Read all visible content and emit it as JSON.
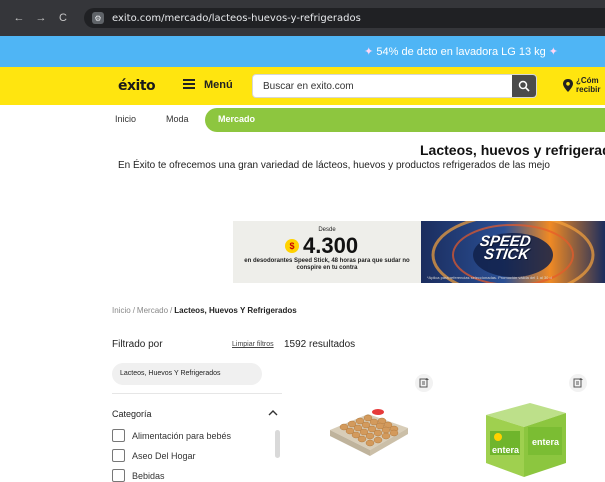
{
  "browser": {
    "url": "exito.com/mercado/lacteos-huevos-y-refrigerados",
    "back": "←",
    "forward": "→",
    "reload": "C"
  },
  "promo": {
    "text": "54% de dcto en lavadora LG 13 kg"
  },
  "header": {
    "logo": "éxito",
    "menu_label": "Menú",
    "search_placeholder": "Buscar en exito.com",
    "location_line1": "¿Cóm",
    "location_line2": "recibir"
  },
  "nav": {
    "items": [
      "Inicio",
      "Moda"
    ],
    "active": "Mercado"
  },
  "page": {
    "title": "Lacteos, huevos y refrigerado",
    "description": "En Éxito te ofrecemos una gran variedad de lácteos, huevos y productos refrigerados de las mejo"
  },
  "banner": {
    "desde": "Desde",
    "price_sign": "$",
    "price": "4.300",
    "subtitle": "en desodorantes Speed Stick, 48 horas para que sudar no conspire en tu contra",
    "brand_line1": "SPEED",
    "brand_line2": "STICK",
    "fine_print": "*Aplica para referencias seleccionadas. Promoción válida del 1 al 30 d"
  },
  "breadcrumb": {
    "items": [
      "Inicio",
      "Mercado"
    ],
    "current": "Lacteos, Huevos Y Refrigerados"
  },
  "filters": {
    "title": "Filtrado por",
    "clear": "Limpiar filtros",
    "results": "1592 resultados",
    "active_chip": "Lacteos, Huevos Y Refrigerados",
    "category_title": "Categoría",
    "options": [
      "Alimentación para bebés",
      "Aseo Del Hogar",
      "Bebidas"
    ]
  },
  "products": {
    "cheese_brand": "entera"
  },
  "colors": {
    "promo_bar": "#4fb5f5",
    "header": "#ffe50f",
    "mercado_tab": "#8dc63f"
  }
}
